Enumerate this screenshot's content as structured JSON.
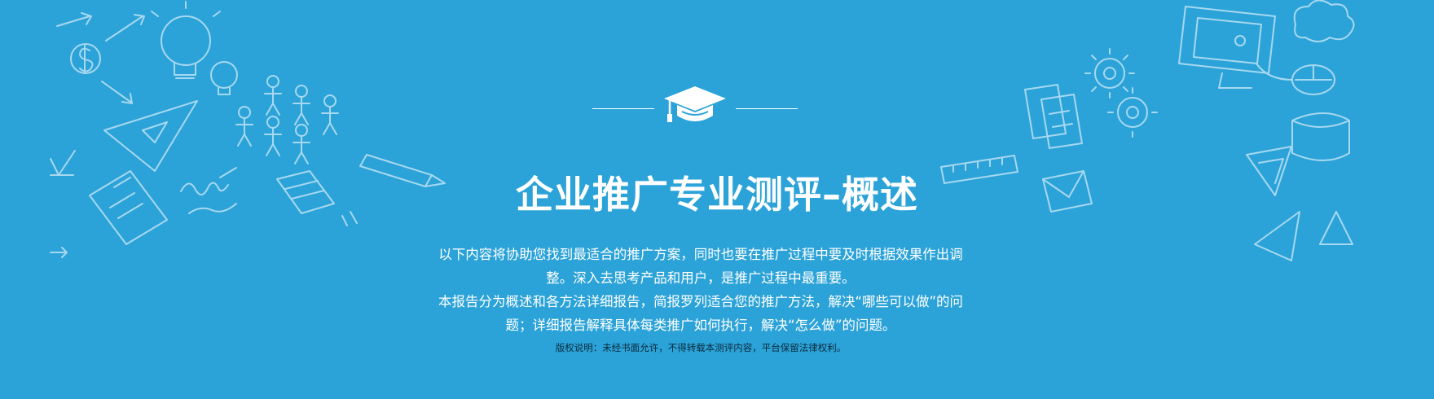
{
  "banner": {
    "background_color": "#2ca3d8",
    "doodle_color": "#cfeaf8",
    "icon": "graduation-cap-icon",
    "title": "企业推广专业测评–概述",
    "paragraphs": [
      "以下内容将协助您找到最适合的推广方案，同时也要在推广过程中要及时根据效果作出调整。深入去思考产品和用户，是推广过程中最重要。",
      "本报告分为概述和各方法详细报告，简报罗列适合您的推广方法，解决“哪些可以做”的问题；详细报告解释具体每类推广如何执行，解决“怎么做”的问题。"
    ],
    "copyright": "版权说明：未经书面允许，不得转载本测评内容，平台保留法律权利。"
  }
}
